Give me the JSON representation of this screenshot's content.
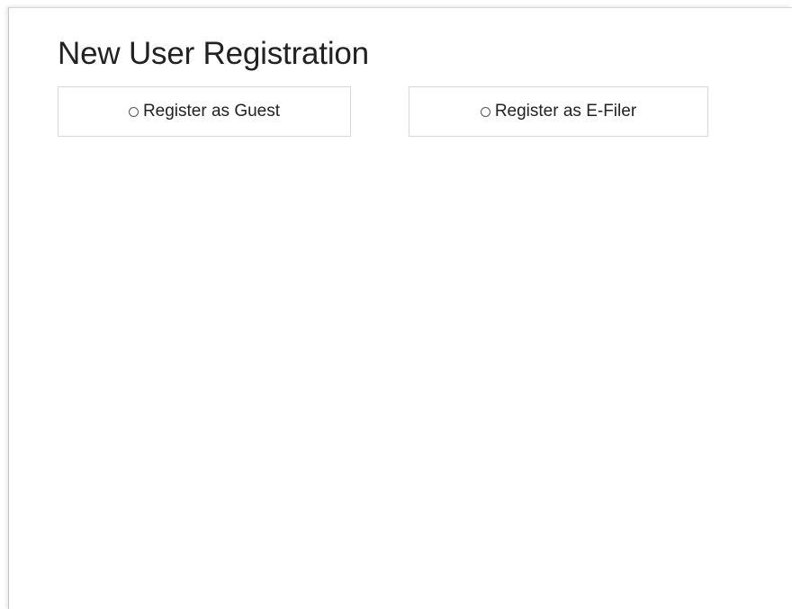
{
  "page": {
    "title": "New User Registration"
  },
  "registration_options": [
    {
      "label": "Register as Guest",
      "selected": false,
      "icon": "radio-unchecked-icon"
    },
    {
      "label": "Register as E-Filer",
      "selected": false,
      "icon": "radio-unchecked-icon"
    }
  ]
}
